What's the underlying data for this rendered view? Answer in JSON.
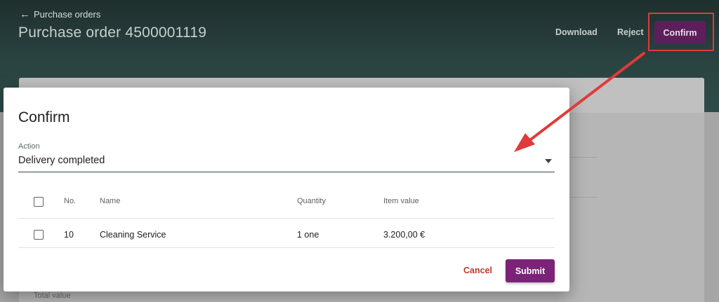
{
  "header": {
    "back_label": "Purchase orders",
    "title": "Purchase order 4500001119",
    "download_label": "Download",
    "reject_label": "Reject",
    "confirm_label": "Confirm"
  },
  "background": {
    "total_label": "Total value"
  },
  "modal": {
    "title": "Confirm",
    "action_label": "Action",
    "action_value": "Delivery completed",
    "table": {
      "columns": [
        "No.",
        "Name",
        "Quantity",
        "Item value"
      ],
      "rows": [
        {
          "no": "10",
          "name": "Cleaning Service",
          "quantity": "1 one",
          "value": "3.200,00 €"
        }
      ]
    },
    "cancel_label": "Cancel",
    "submit_label": "Submit"
  },
  "colors": {
    "primary": "#7b2378",
    "cancel": "#c0392b",
    "annotation": "#e03a3a"
  }
}
